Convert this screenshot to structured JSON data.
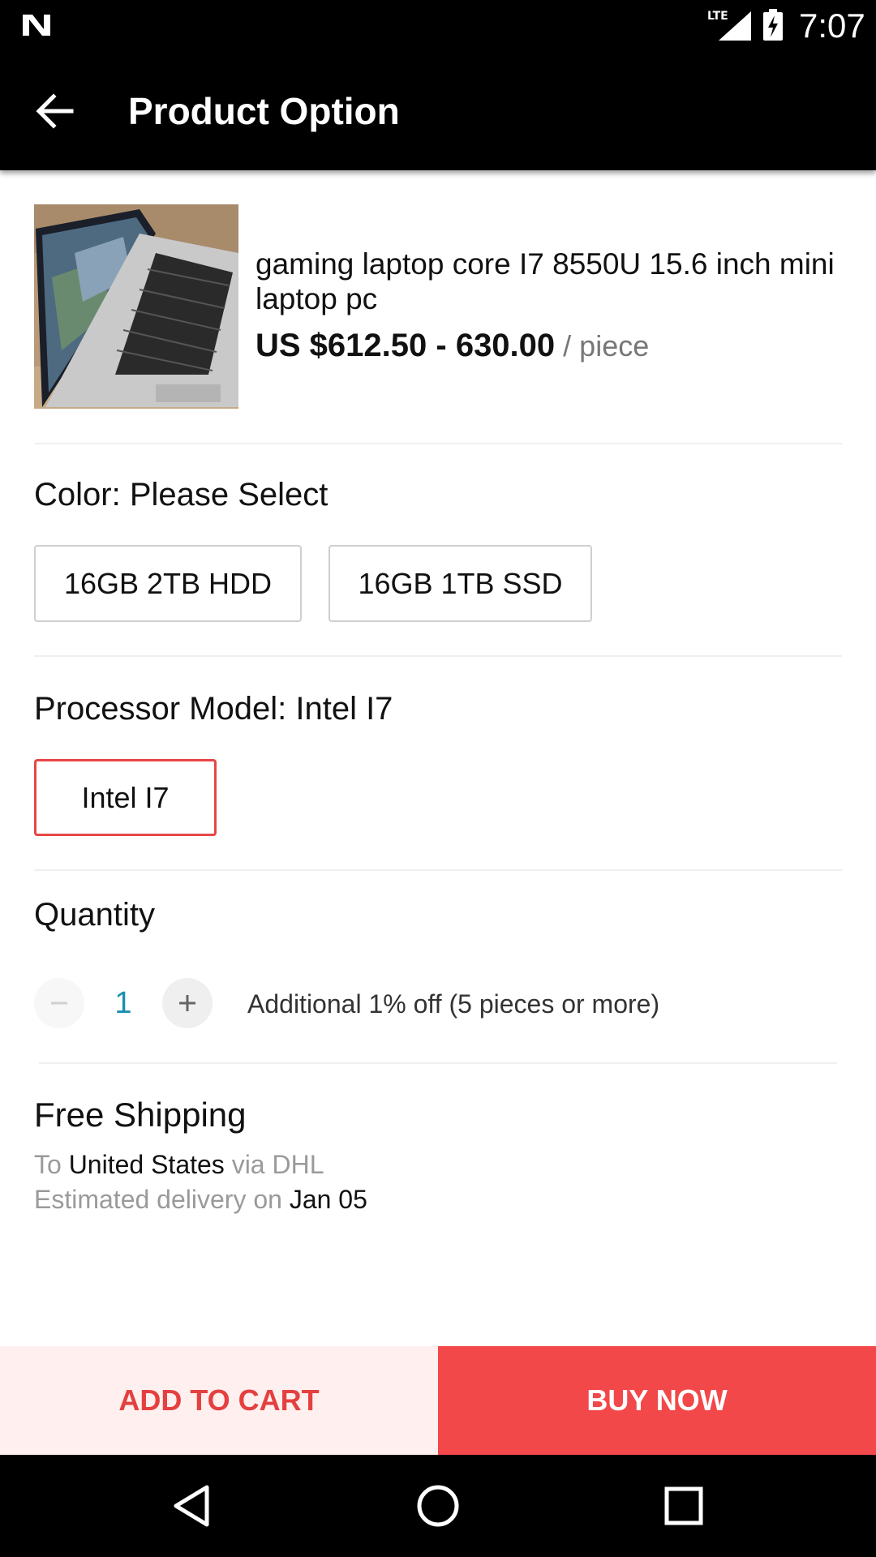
{
  "status_bar": {
    "time": "7:07",
    "network": "LTE"
  },
  "app_bar": {
    "title": "Product Option",
    "back_icon": "arrow-back-icon"
  },
  "product": {
    "name": "gaming laptop core I7 8550U 15.6 inch mini laptop pc",
    "price": "US $612.50 - 630.00",
    "unit": "/ piece",
    "image": "laptop-photo"
  },
  "color_section": {
    "label": "Color: Please Select",
    "options": [
      "16GB 2TB HDD",
      "16GB 1TB SSD"
    ]
  },
  "processor_section": {
    "label": "Processor Model: Intel I7",
    "options": [
      "Intel I7"
    ],
    "selected": "Intel I7"
  },
  "quantity": {
    "label": "Quantity",
    "value": "1",
    "note": "Additional 1% off (5 pieces or more)"
  },
  "shipping": {
    "title": "Free Shipping",
    "to_prefix": "To",
    "country": "United States",
    "via": "via DHL",
    "delivery_prefix": "Estimated delivery on",
    "delivery_date": "Jan 05"
  },
  "actions": {
    "add_to_cart": "ADD TO CART",
    "buy_now": "BUY NOW"
  },
  "colors": {
    "accent": "#f2484a",
    "selected_border": "#e84545",
    "quantity_value": "#1a8fb0"
  }
}
